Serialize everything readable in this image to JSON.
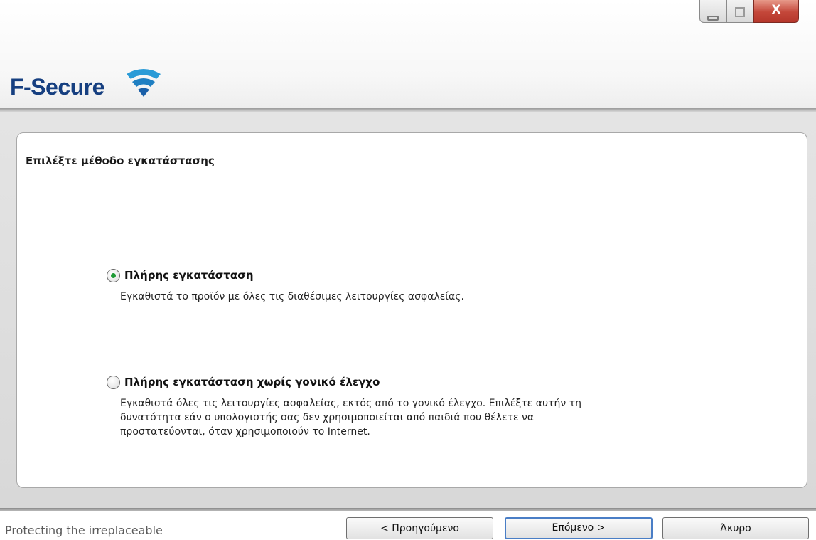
{
  "window": {
    "controls": {
      "minimize_icon": "minimize-icon",
      "maximize_icon": "maximize-icon",
      "close_label": "X"
    }
  },
  "header": {
    "logo_text": "F-Secure",
    "logo_icon": "wifi-signal-icon",
    "brand_color": "#163f80"
  },
  "page": {
    "section_title": "Επιλέξτε μέθοδο εγκατάστασης",
    "options": [
      {
        "title": "Πλήρης εγκατάσταση",
        "selected": true,
        "description": [
          "Εγκαθιστά το προϊόν με όλες τις διαθέσιμες λειτουργίες ασφαλείας."
        ]
      },
      {
        "title": "Πλήρης εγκατάσταση χωρίς γονικό έλεγχο",
        "selected": false,
        "description": [
          "Εγκαθιστά όλες τις λειτουργίες ασφαλείας, εκτός από το γονικό έλεγχο. Επιλέξτε αυτήν τη",
          "δυνατότητα εάν ο υπολογιστής σας δεν χρησιμοποιείται από παιδιά που θέλετε να",
          "προστατεύονται, όταν χρησιμοποιούν το Internet."
        ]
      }
    ]
  },
  "footer": {
    "tagline": "Protecting the irreplaceable",
    "back_label": "< Προηγούμενο",
    "next_label": "Επόμενο >",
    "cancel_label": "Άκυρο"
  },
  "colors": {
    "radio_selected": "#1e9a35",
    "default_button_border": "#4a7ec6",
    "close_button": "#c4473a"
  }
}
